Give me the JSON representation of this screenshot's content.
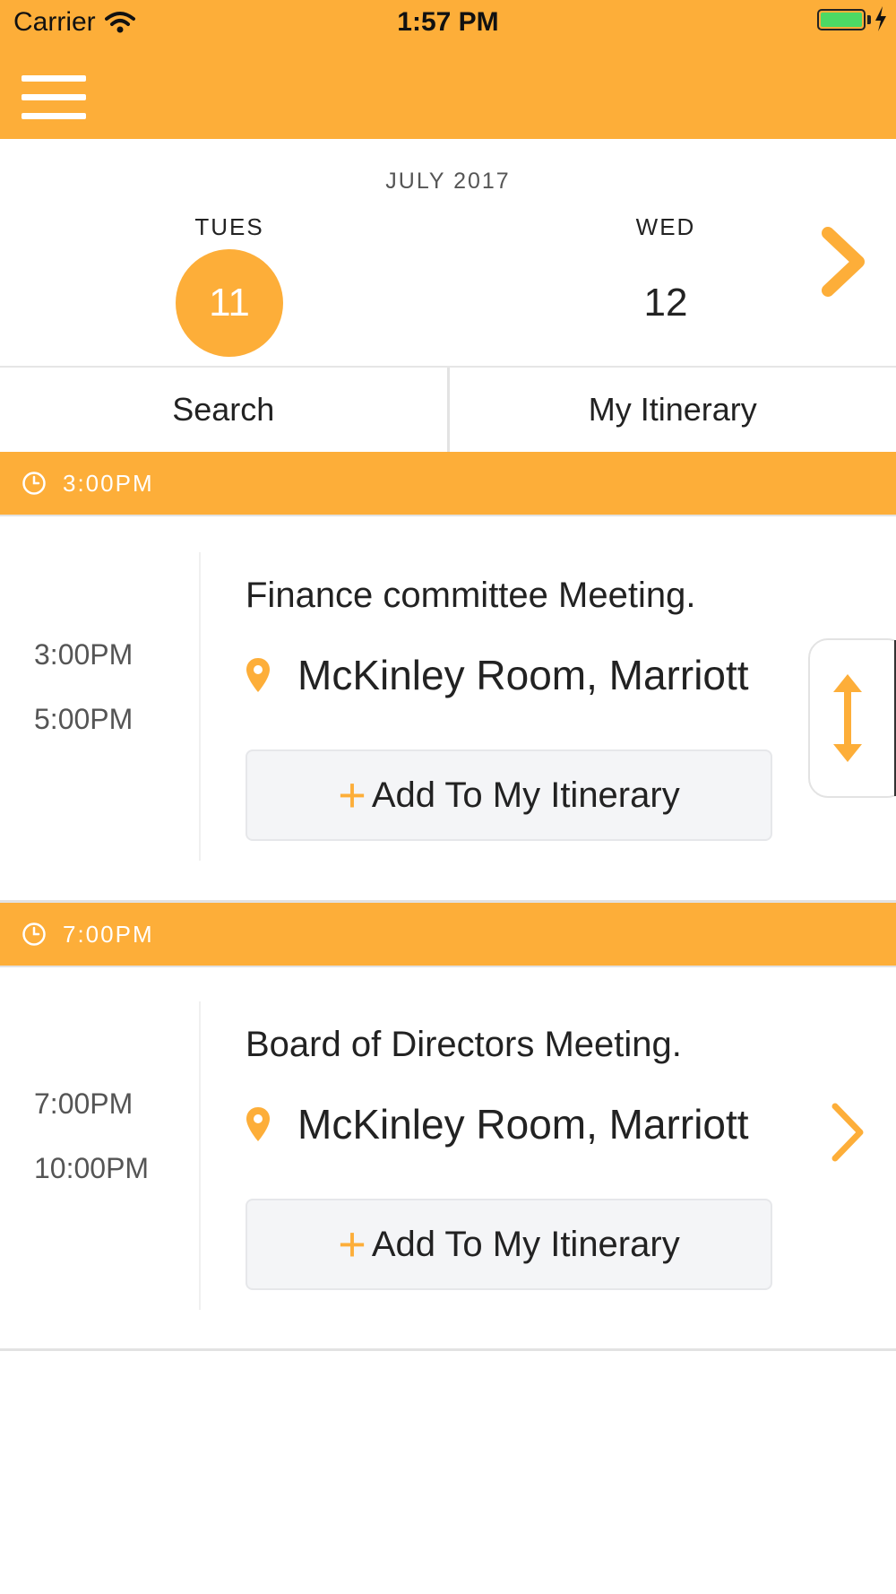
{
  "status_bar": {
    "carrier": "Carrier",
    "time": "1:57 PM"
  },
  "colors": {
    "accent": "#FDAE39",
    "battery": "#4CD964"
  },
  "calendar": {
    "month": "JULY 2017",
    "days": [
      {
        "name": "TUES",
        "number": "11",
        "selected": true
      },
      {
        "name": "WED",
        "number": "12",
        "selected": false
      }
    ],
    "next_icon": "chevron-right-icon"
  },
  "tabs": [
    {
      "label": "Search"
    },
    {
      "label": "My Itinerary"
    }
  ],
  "sections": [
    {
      "time_header": "3:00PM",
      "event": {
        "start": "3:00PM",
        "end": "5:00PM",
        "title": "Finance committee Meeting.",
        "location": "McKinley Room, Marriott",
        "add_label": "Add To My Itinerary"
      }
    },
    {
      "time_header": "7:00PM",
      "event": {
        "start": "7:00PM",
        "end": "10:00PM",
        "title": "Board of Directors Meeting.",
        "location": "McKinley Room, Marriott",
        "add_label": "Add To My Itinerary"
      }
    }
  ],
  "icons": {
    "menu": "hamburger-menu-icon",
    "clock": "clock-icon",
    "pin": "location-pin-icon",
    "plus": "plus-icon",
    "resize": "vertical-resize-arrow-icon",
    "row_chevron": "chevron-right-icon"
  }
}
